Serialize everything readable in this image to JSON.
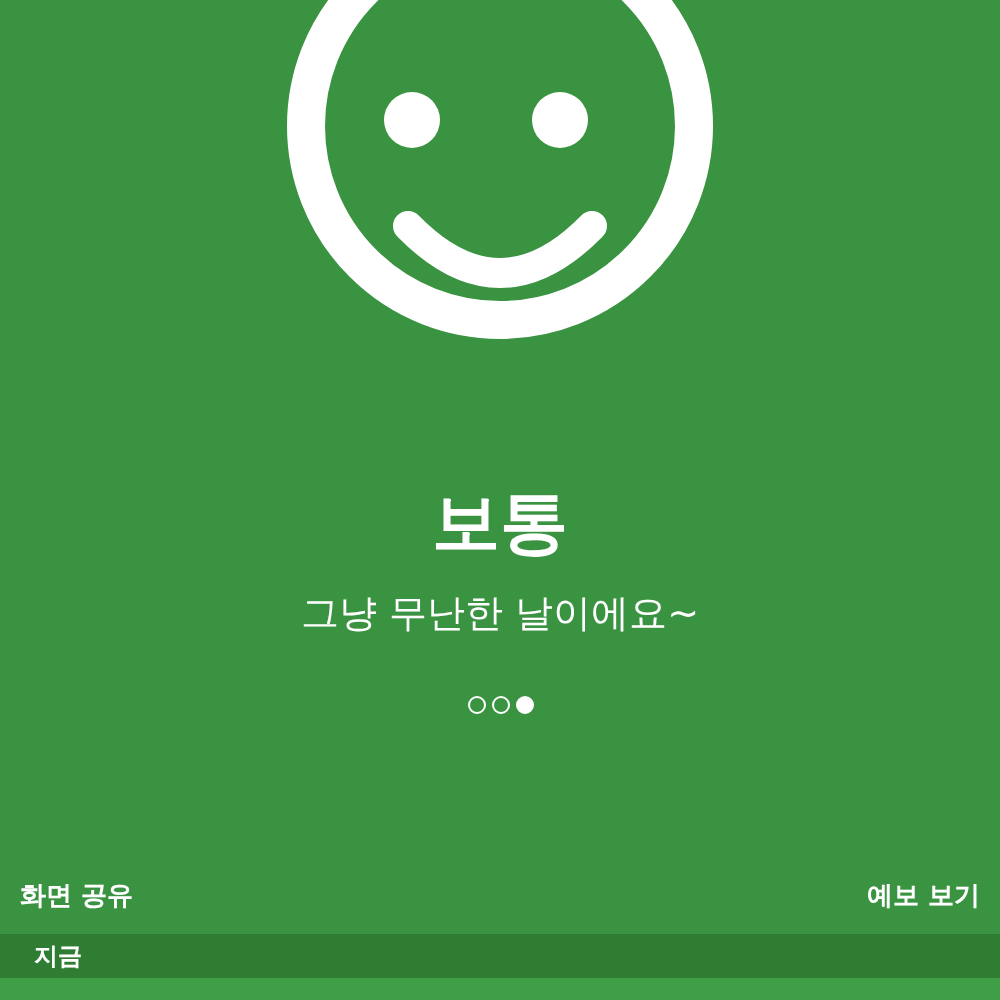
{
  "mood": {
    "title": "보통",
    "message": "그냥 무난한 날이에요~"
  },
  "pages": [
    {
      "selected": false
    },
    {
      "selected": false
    },
    {
      "selected": true
    }
  ],
  "actions": {
    "share": "화면 공유",
    "forecast": "예보 보기"
  },
  "section": {
    "label": "지금"
  }
}
